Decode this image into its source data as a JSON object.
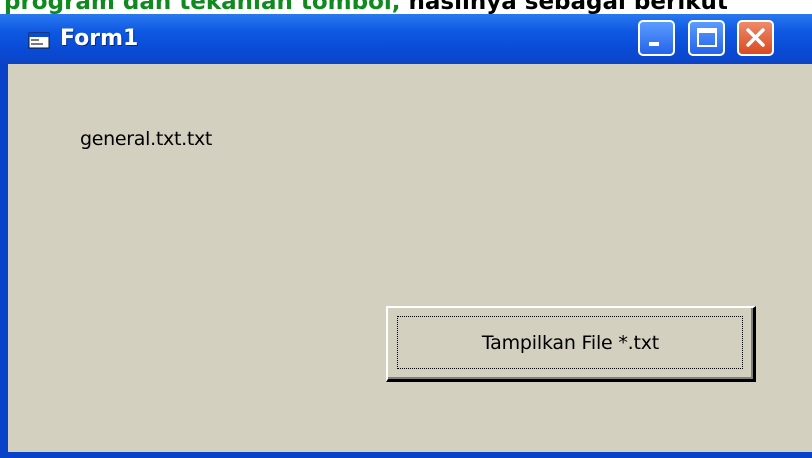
{
  "document_strip": {
    "green_text": "program dan tekanlah tombol,",
    "black_text": "hasilnya sebagai berikut"
  },
  "window": {
    "title": "Form1",
    "icon": "form-window-icon",
    "controls": {
      "minimize_icon": "minimize-icon",
      "maximize_icon": "maximize-icon",
      "close_icon": "close-icon"
    }
  },
  "form": {
    "label_text": "general.txt.txt",
    "button_label": "Tampilkan File *.txt"
  },
  "colors": {
    "titlebar": "#0a4bd6",
    "client_background": "#d4d0c0",
    "close_button": "#d94a22",
    "document_green": "#0f8a1e"
  }
}
